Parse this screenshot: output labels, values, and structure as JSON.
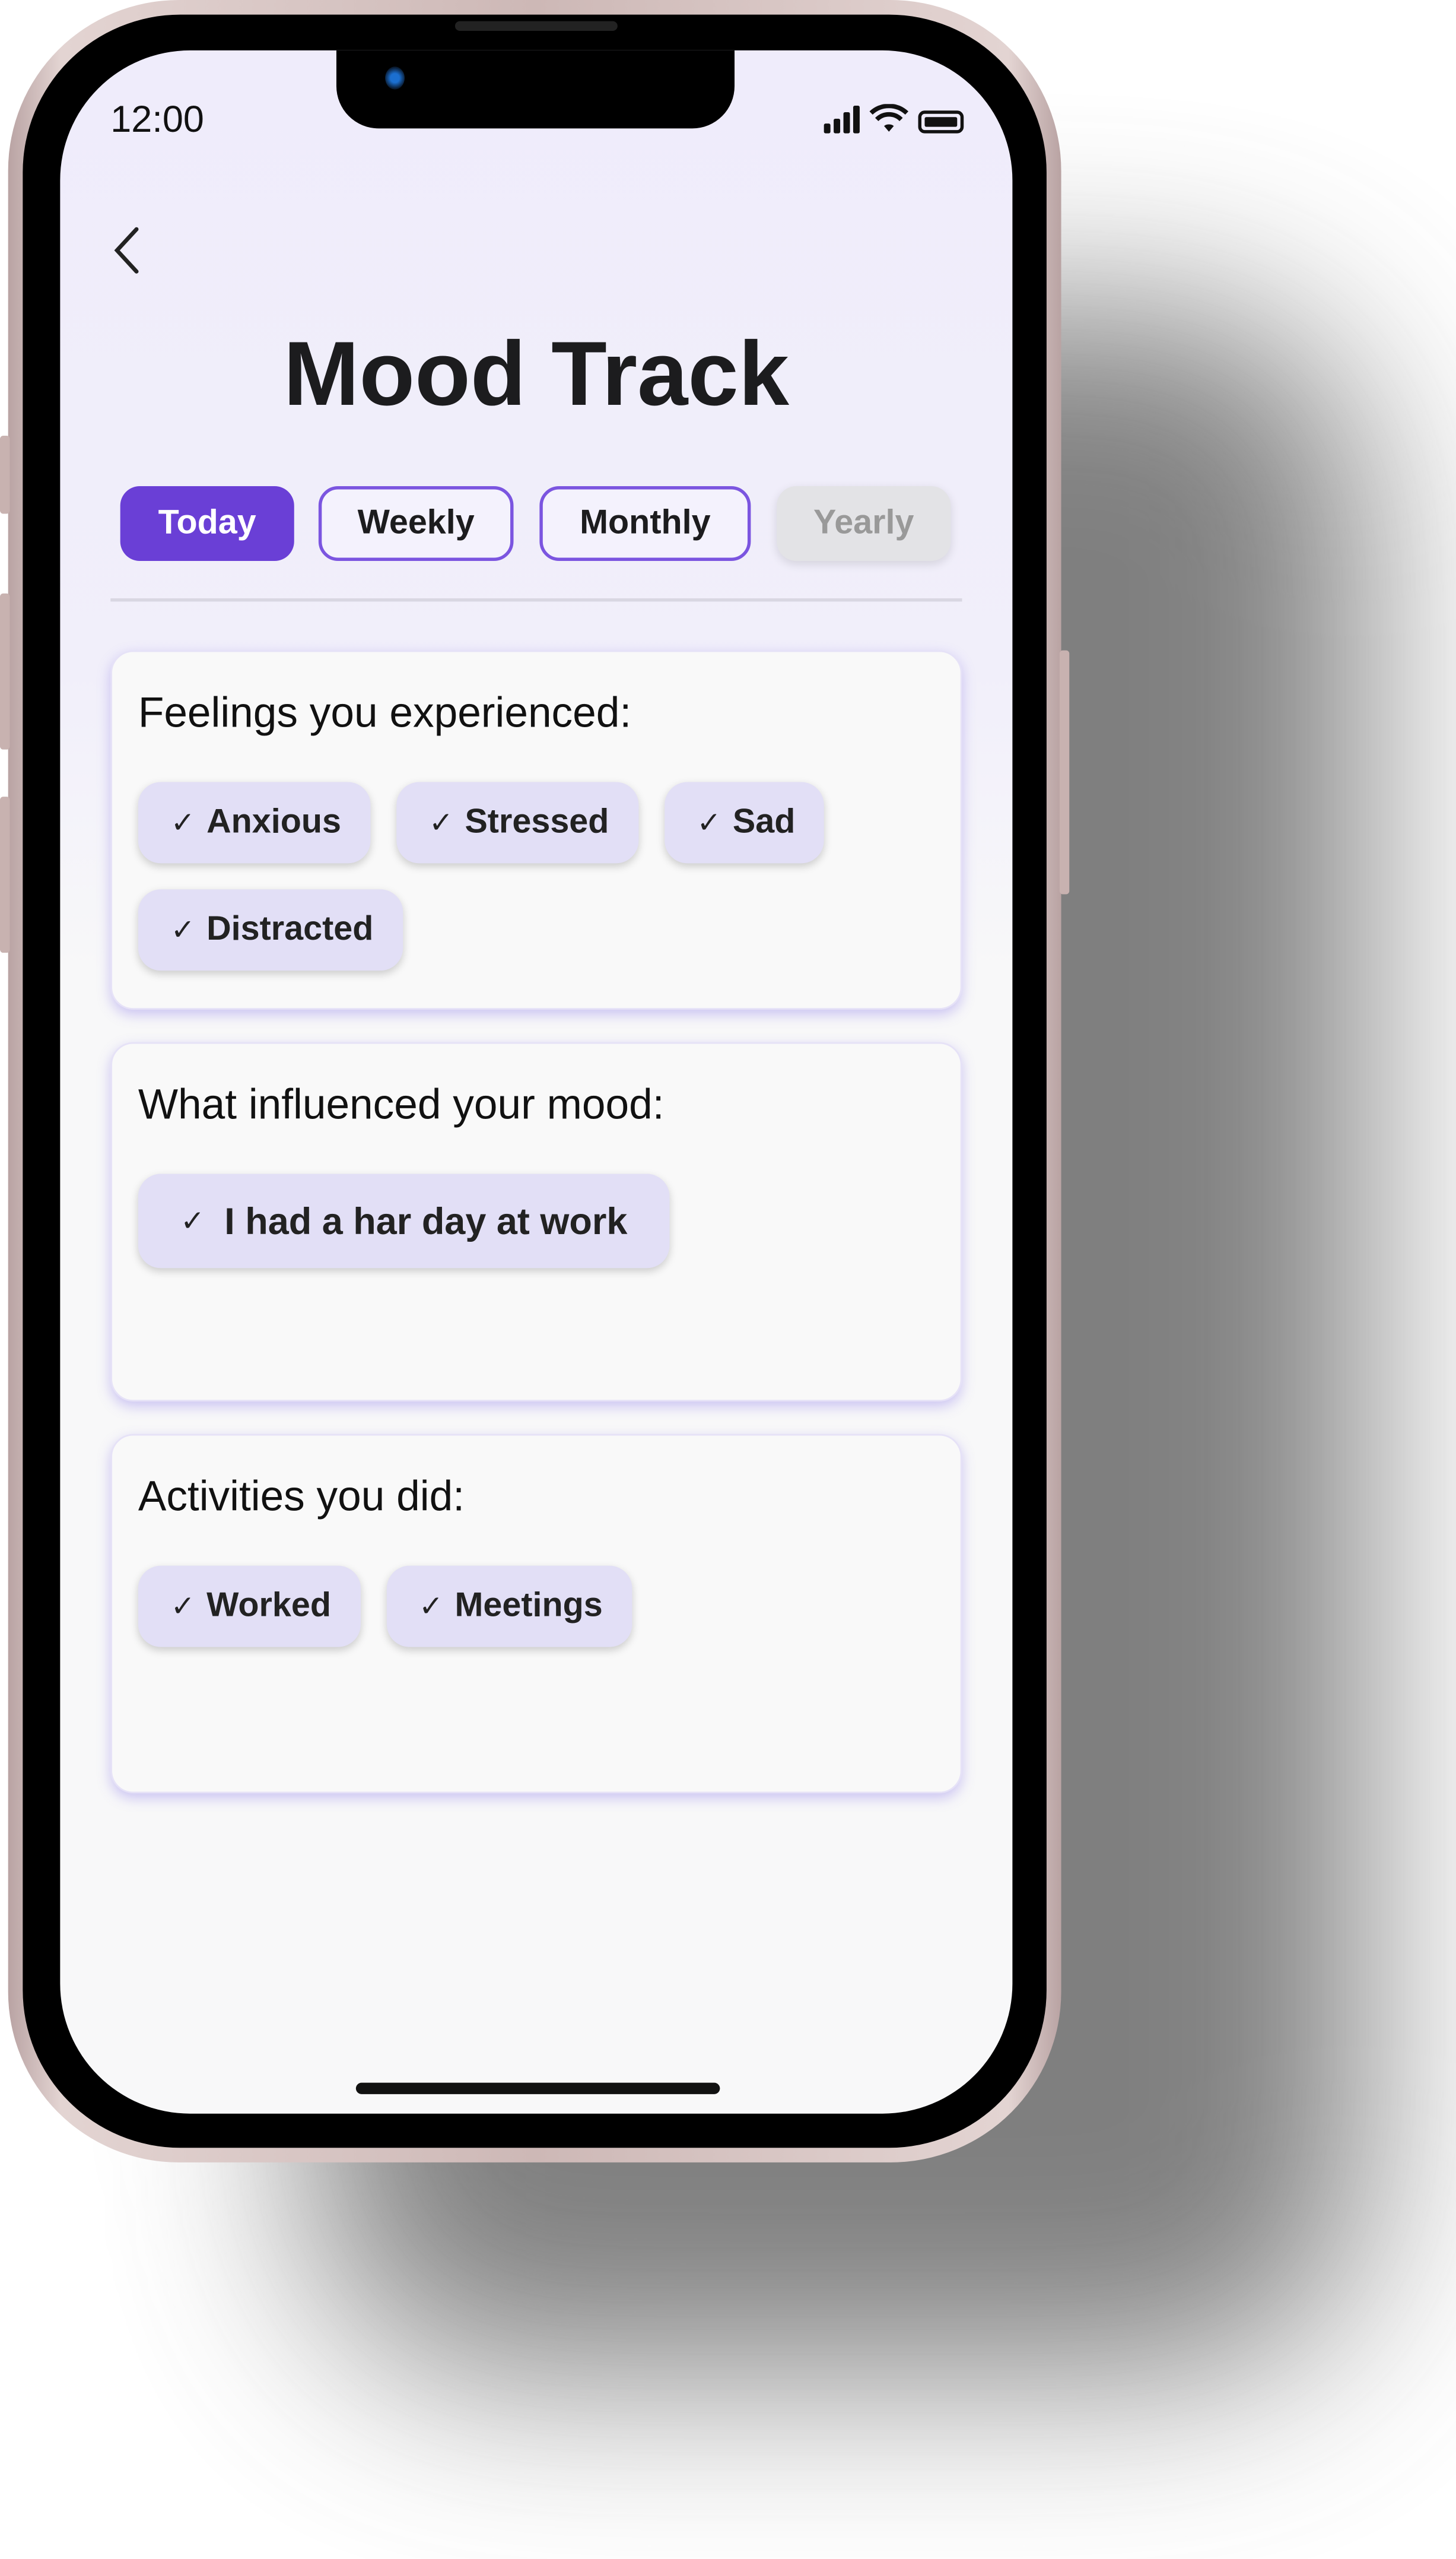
{
  "status_bar": {
    "time": "12:00",
    "icons": [
      "signal-icon",
      "wifi-icon",
      "battery-icon"
    ]
  },
  "header": {
    "back_icon": "chevron-left-icon",
    "title": "Mood Track"
  },
  "tabs": [
    {
      "label": "Today",
      "state": "active"
    },
    {
      "label": "Weekly",
      "state": "default"
    },
    {
      "label": "Monthly",
      "state": "default"
    },
    {
      "label": "Yearly",
      "state": "disabled"
    }
  ],
  "sections": [
    {
      "heading": "Feelings you experienced:",
      "chips": [
        "Anxious",
        "Stressed",
        "Sad",
        "Distracted"
      ]
    },
    {
      "heading": "What influenced your mood:",
      "chips": [
        "I had a har day at work"
      ]
    },
    {
      "heading": "Activities you did:",
      "chips": [
        "Worked",
        "Meetings"
      ]
    }
  ],
  "colors": {
    "accent": "#6a3fd6",
    "chip_bg": "#e2dff6",
    "screen_bg": "#efecfb"
  }
}
